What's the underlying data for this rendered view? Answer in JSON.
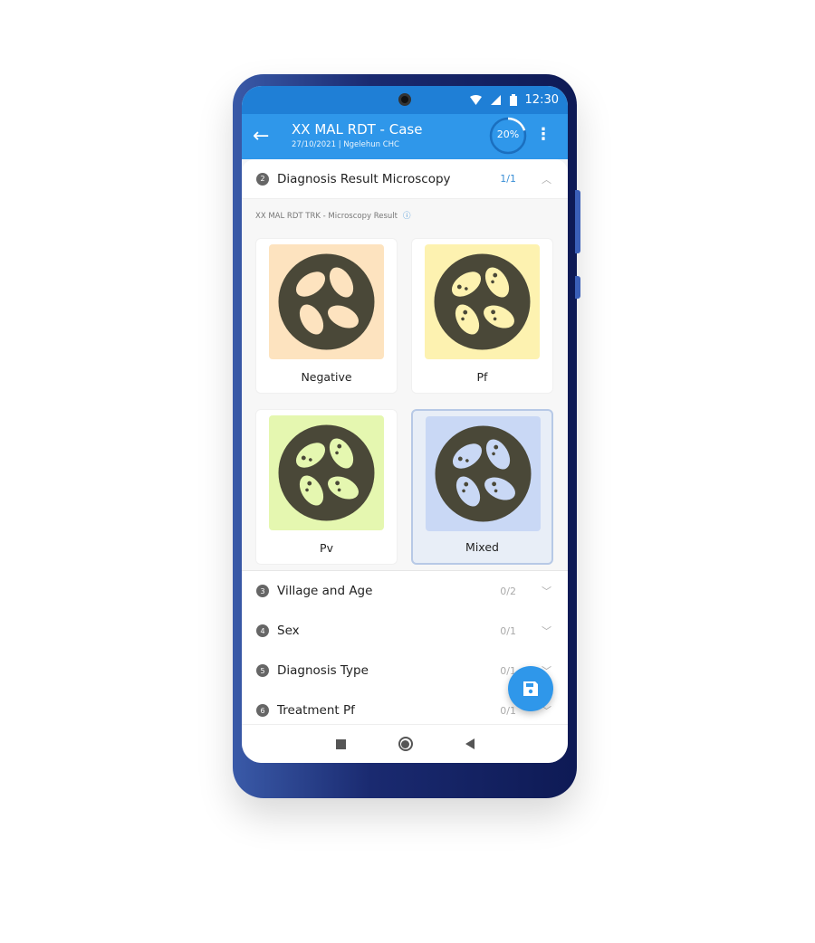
{
  "status": {
    "time": "12:30"
  },
  "appbar": {
    "title": "XX MAL RDT - Case",
    "subtitle": "27/10/2021 | Ngelehun CHC",
    "progress_label": "20%",
    "progress": 0.2
  },
  "sections": [
    {
      "num": "2",
      "label": "Diagnosis Result Microscopy",
      "count": "1/1",
      "expanded": true
    },
    {
      "num": "3",
      "label": "Village and Age",
      "count": "0/2"
    },
    {
      "num": "4",
      "label": "Sex",
      "count": "0/1"
    },
    {
      "num": "5",
      "label": "Diagnosis Type",
      "count": "0/1"
    },
    {
      "num": "6",
      "label": "Treatment Pf",
      "count": "0/1"
    }
  ],
  "question": {
    "label": "XX MAL RDT TRK - Microscopy Result",
    "options": [
      {
        "label": "Negative",
        "bg": "#fde3bf",
        "cell": "#fde3bf",
        "selected": false
      },
      {
        "label": "Pf",
        "bg": "#fdf2b0",
        "cell": "#fdf2b0",
        "selected": false
      },
      {
        "label": "Pv",
        "bg": "#e5f7b0",
        "cell": "#e5f7b0",
        "selected": false
      },
      {
        "label": "Mixed",
        "bg": "#c9d8f5",
        "cell": "#c9d8f5",
        "selected": true
      }
    ]
  },
  "colors": {
    "primary": "#2f97ea",
    "status": "#1f7fd6"
  }
}
